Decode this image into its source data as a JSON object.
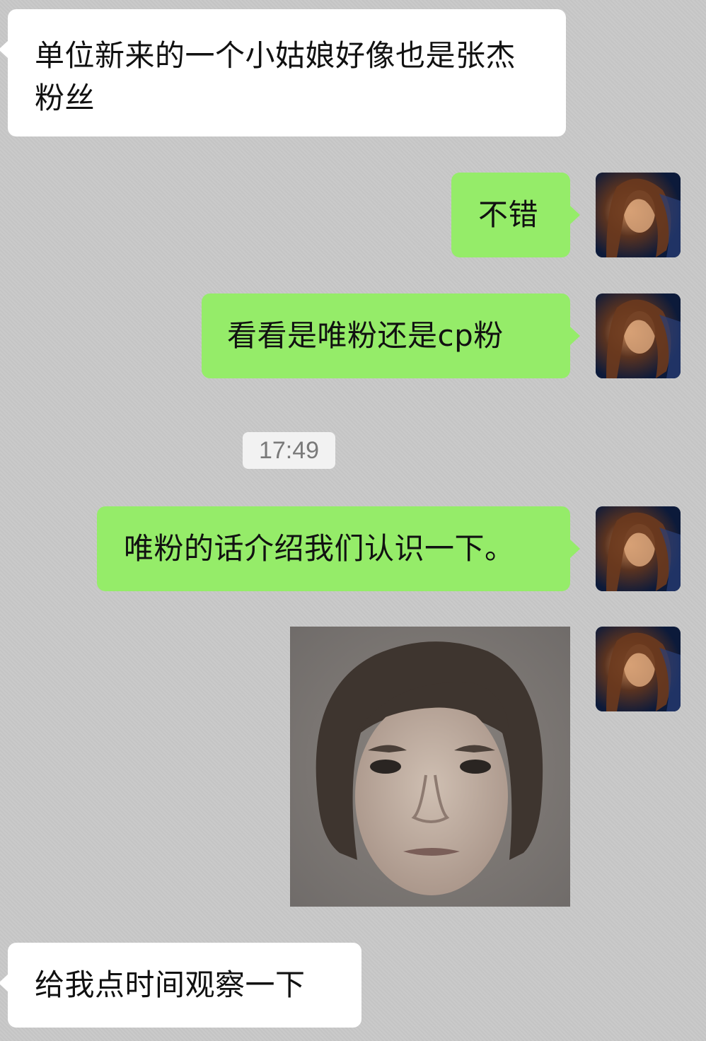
{
  "messages": [
    {
      "side": "left",
      "text": "单位新来的一个小姑娘好像也是张杰粉丝"
    },
    {
      "side": "right",
      "text": "不错"
    },
    {
      "side": "right",
      "text": "看看是唯粉还是cp粉"
    },
    {
      "side": "right",
      "text": "唯粉的话介绍我们认识一下。"
    },
    {
      "side": "left",
      "text": "给我点时间观察一下"
    }
  ],
  "timestamp": "17:49",
  "colors": {
    "chat_background": "#c8c8c8",
    "incoming_bubble": "#ffffff",
    "outgoing_bubble": "#95ec69"
  },
  "icons": {
    "avatar": "avatar-photo-icon",
    "image": "face-photo-icon"
  }
}
